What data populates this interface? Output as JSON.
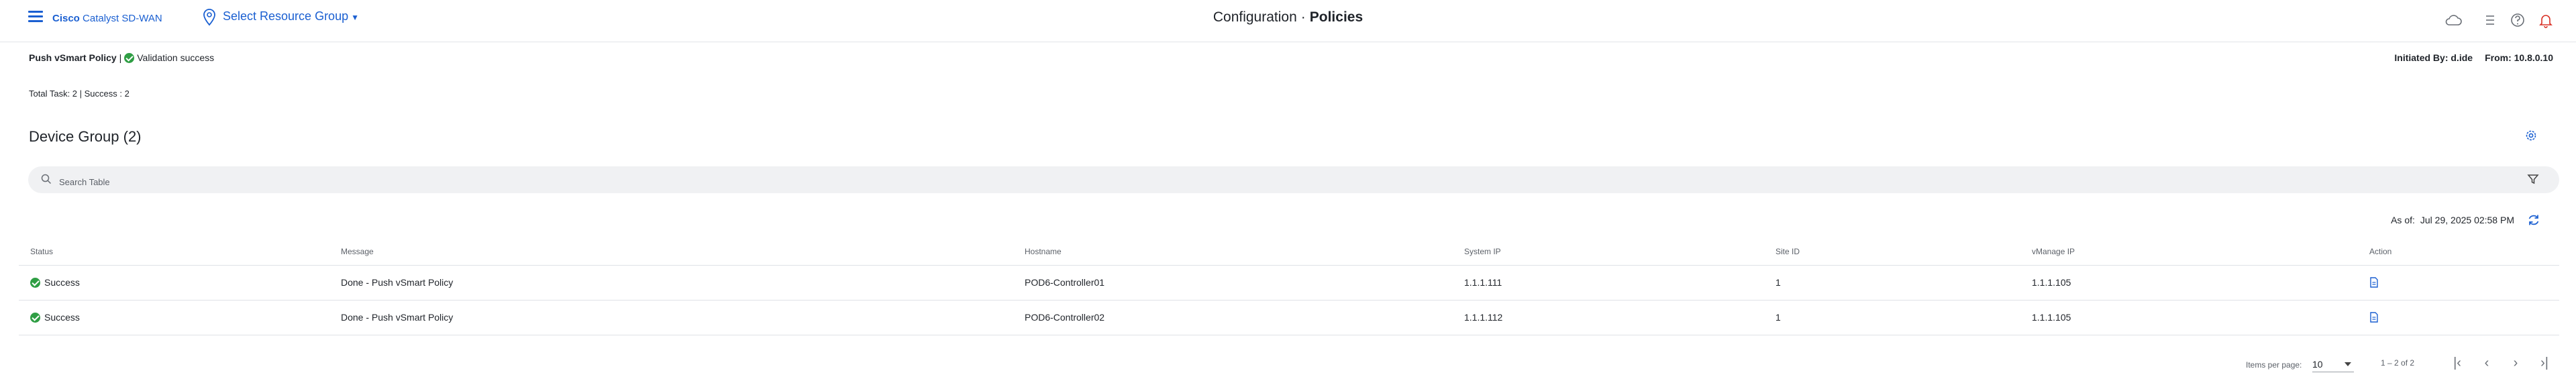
{
  "header": {
    "brand_prefix": "Cisco",
    "brand_name": "Catalyst SD-WAN",
    "resource_group": "Select Resource Group",
    "title_section": "Configuration",
    "title_page": "Policies"
  },
  "task": {
    "name": "Push vSmart Policy",
    "separator": "|",
    "validation": "Validation success",
    "initiated_by": "Initiated By: d.ide",
    "from": "From: 10.8.0.10",
    "totals": "Total Task: 2 | Success : 2"
  },
  "device_group": {
    "title": "Device Group (2)"
  },
  "search": {
    "placeholder": "Search Table",
    "value": ""
  },
  "as_of": {
    "label": "As of:",
    "value": "Jul 29, 2025 02:58 PM"
  },
  "table": {
    "columns": [
      "Status",
      "Message",
      "Hostname",
      "System IP",
      "Site ID",
      "vManage IP",
      "Action"
    ],
    "rows": [
      {
        "status": "Success",
        "message": "Done - Push vSmart Policy",
        "hostname": "POD6-Controller01",
        "system_ip": "1.1.1.111",
        "site_id": "1",
        "vmanage_ip": "1.1.1.105"
      },
      {
        "status": "Success",
        "message": "Done - Push vSmart Policy",
        "hostname": "POD6-Controller02",
        "system_ip": "1.1.1.112",
        "site_id": "1",
        "vmanage_ip": "1.1.1.105"
      }
    ]
  },
  "pagination": {
    "items_per_page_label": "Items per page:",
    "items_per_page": "10",
    "range": "1 – 2 of 2"
  },
  "colors": {
    "accent": "#1a5fd1",
    "success": "#2f9e44",
    "alert": "#d93025"
  },
  "icons": [
    "menu-icon",
    "location-pin-icon",
    "cloud-icon",
    "list-icon",
    "help-icon",
    "bell-icon",
    "gear-icon",
    "search-icon",
    "filter-icon",
    "refresh-icon",
    "document-icon"
  ]
}
